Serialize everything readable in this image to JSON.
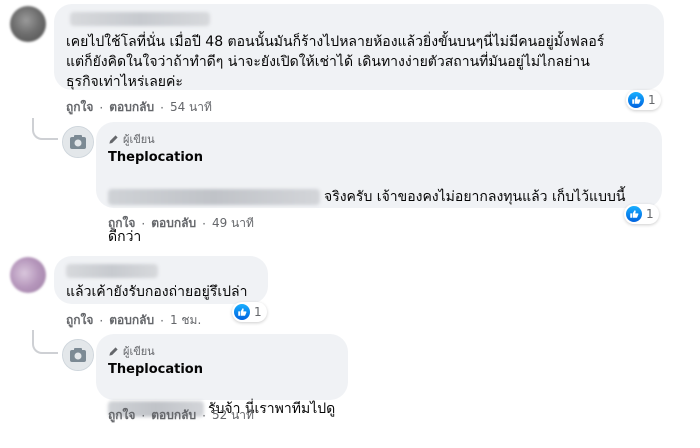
{
  "comments": [
    {
      "text": "เคยไปใช้โลที่นั่น เมื่อปี 48 ตอนนั้นมันก็ร้างไปหลายห้องแล้วยิ่งขั้นบนๆนี่ไม่มีคนอยู่มั้งฟลอร์\nแต่ก็ยังคิดในใจว่าถ้าทำดีๆ น่าจะยังเปิดให้เช่าได้ เดินทางง่ายตัวสถานที่มันอยู่ไม่ไกลย่าน\nธุรกิจเท่าไหร่เลยค่ะ",
      "like_label": "ถูกใจ",
      "reply_label": "ตอบกลับ",
      "time": "54 นาที",
      "reactions": "1",
      "reply": {
        "author_badge": "ผู้เขียน",
        "author": "Theplocation",
        "text_line1": "จริงครับ เจ้าของคงไม่อยากลงทุนแล้ว เก็บไว้แบบนี้",
        "text_line2": "ดีกว่า",
        "like_label": "ถูกใจ",
        "reply_label": "ตอบกลับ",
        "time": "49 นาที",
        "reactions": "1"
      }
    },
    {
      "text": "แล้วเค้ายังรับกองถ่ายอยู่รึเปล่า",
      "like_label": "ถูกใจ",
      "reply_label": "ตอบกลับ",
      "time": "1 ชม.",
      "reactions": "1",
      "reply": {
        "author_badge": "ผู้เขียน",
        "author": "Theplocation",
        "text_line1": "รับจ้า นี่เราพาทีมไปดู",
        "like_label": "ถูกใจ",
        "reply_label": "ตอบกลับ",
        "time": "52 นาที"
      }
    }
  ],
  "colors": {
    "bubble": "#f0f2f5",
    "like_blue": "#1877f2",
    "meta": "#65676b"
  }
}
